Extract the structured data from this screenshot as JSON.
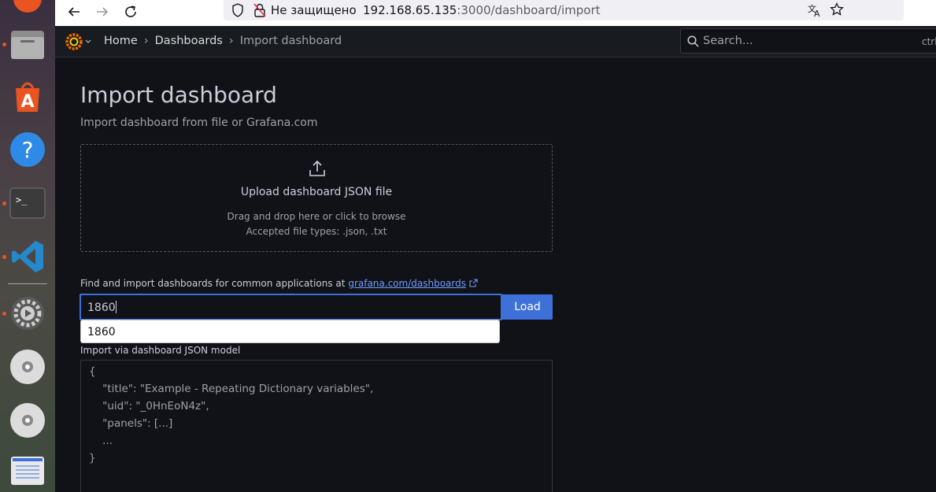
{
  "browser": {
    "security_label": "Не защищено",
    "url_host": "192.168.65.135",
    "url_path": ":3000/dashboard/import"
  },
  "breadcrumb": {
    "home": "Home",
    "dashboards": "Dashboards",
    "current": "Import dashboard"
  },
  "search": {
    "placeholder": "Search...",
    "shortcut": "ctrl"
  },
  "page": {
    "title": "Import dashboard",
    "subtitle": "Import dashboard from file or Grafana.com"
  },
  "upload": {
    "title": "Upload dashboard JSON file",
    "hint": "Drag and drop here or click to browse",
    "types": "Accepted file types: .json, .txt"
  },
  "grafana_import": {
    "label": "Find and import dashboards for common applications at",
    "link_text": "grafana.com/dashboards",
    "input_value": "1860",
    "load_label": "Load",
    "suggestion": "1860"
  },
  "json_model": {
    "label": "Import via dashboard JSON model",
    "placeholder_lines": [
      "{",
      "    \"title\": \"Example - Repeating Dictionary variables\",",
      "    \"uid\": \"_0HnEoN4z\",",
      "    \"panels\": [...]",
      "    ...",
      "}"
    ]
  },
  "colors": {
    "accent": "#3d71d9",
    "link": "#6e9fff",
    "background": "#111217",
    "ubuntu_orange": "#e95420"
  },
  "dock": {
    "icons": [
      "app-center-icon",
      "help-icon",
      "terminal-icon",
      "vscode-icon",
      "settings-icon",
      "disc-icon",
      "disc-icon",
      "text-editor-icon"
    ]
  }
}
